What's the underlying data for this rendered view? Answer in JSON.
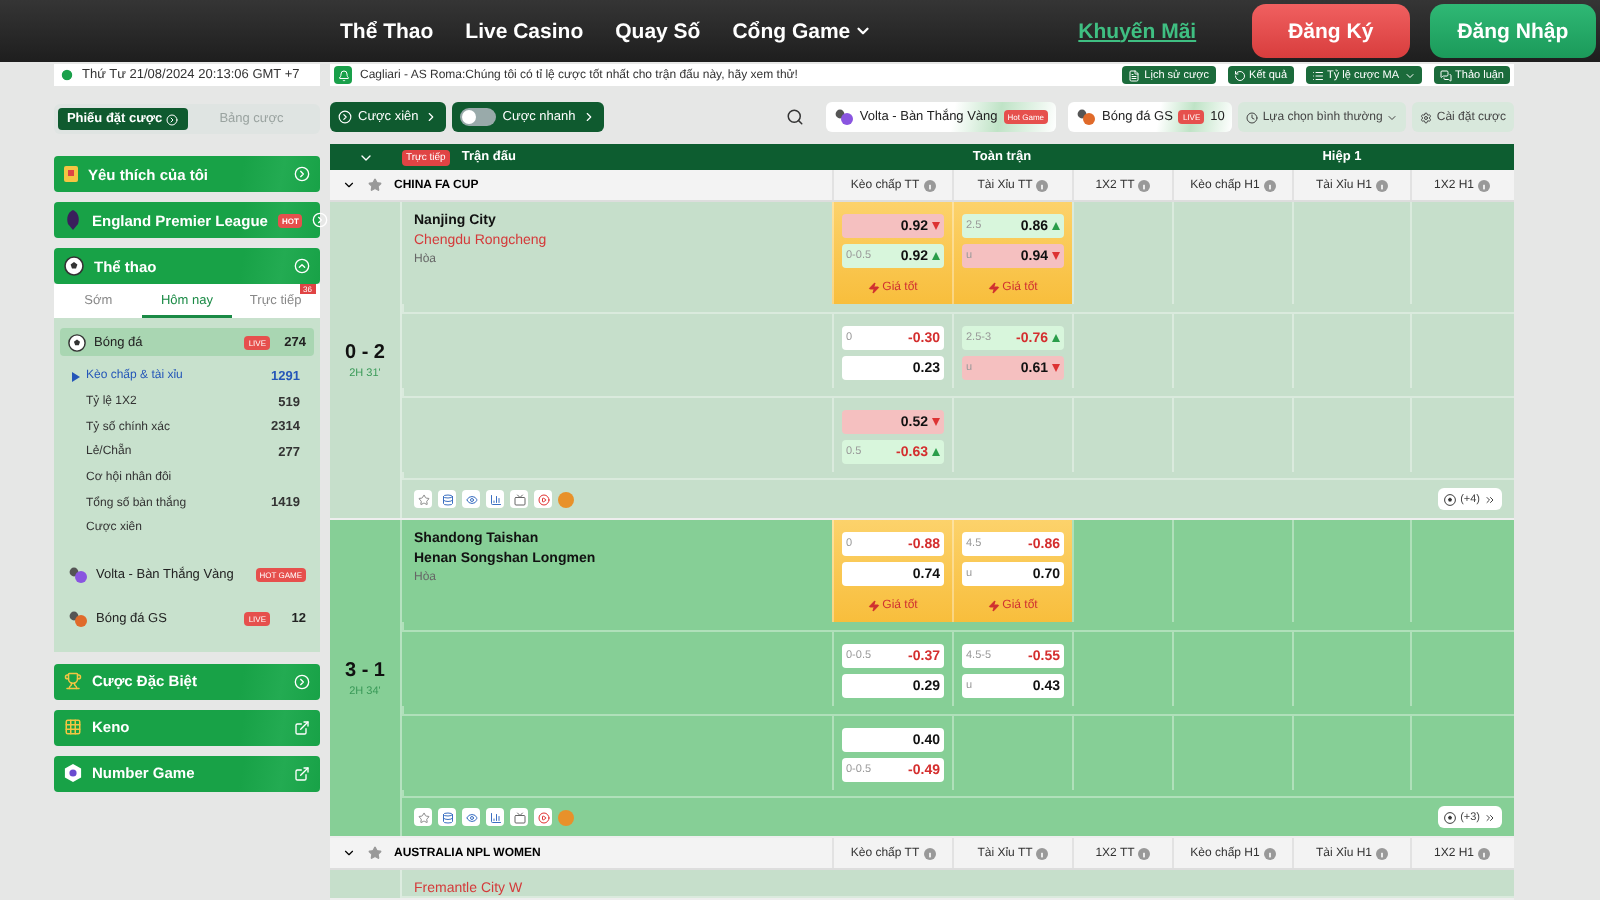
{
  "header": {
    "nav": [
      {
        "label": "Thể Thao",
        "kind": "link"
      },
      {
        "label": "Live Casino",
        "kind": "link"
      },
      {
        "label": "Quay Số",
        "kind": "link"
      },
      {
        "label": "Cổng Game",
        "kind": "dropdown"
      }
    ],
    "promo": "Khuyến Mãi",
    "buttons": [
      {
        "label": "Đăng Ký",
        "kind": "register"
      },
      {
        "label": "Đăng Nhập",
        "kind": "login"
      }
    ]
  },
  "clock": "Thứ Tư 21/08/2024 20:13:06 GMT +7",
  "ticker": "Cagliari - AS Roma:Chúng tôi có tỉ lệ cược tốt nhất cho trận đấu này, hãy xem thử!",
  "tools": [
    {
      "label": "Lịch sử cược",
      "kind": "history"
    },
    {
      "label": "Kết quả",
      "kind": "results"
    },
    {
      "label": "Tỷ lệ cược MA",
      "kind": "odds"
    },
    {
      "label": "Thảo luận",
      "kind": "chat"
    }
  ],
  "sidebar": {
    "slip_tabs": [
      {
        "label": "Phiếu đặt cược",
        "selected": true
      },
      {
        "label": "Bảng cược",
        "selected": false
      }
    ],
    "sections": [
      {
        "label": "Yêu thích của tôi",
        "kind": "favorites"
      },
      {
        "label": "England Premier League",
        "kind": "league",
        "badge": "HOT"
      }
    ],
    "sports": {
      "label": "Thể thao",
      "expanded": true,
      "period_tabs": [
        {
          "label": "Sớm",
          "selected": false
        },
        {
          "label": "Hôm nay",
          "selected": true
        },
        {
          "label": "Trực tiếp",
          "selected": false,
          "badge": "36"
        }
      ],
      "items": [
        {
          "label": "Bóng đá",
          "kind": "ball",
          "badge": "LIVE",
          "count": "274",
          "expanded": true,
          "children": [
            {
              "label": "Kèo chấp & tài xỉu",
              "count": "1291",
              "selected": true
            },
            {
              "label": "Tỷ lệ 1X2",
              "count": "519",
              "selected": false
            },
            {
              "label": "Tỷ số chính xác",
              "count": "2314",
              "selected": false
            },
            {
              "label": "Lẻ/Chẵn",
              "count": "277",
              "selected": false
            },
            {
              "label": "Cơ hội nhân đôi",
              "selected": false
            },
            {
              "label": "Tổng số bàn thắng",
              "count": "1419",
              "selected": false
            },
            {
              "label": "Cược xiên",
              "selected": false
            }
          ]
        },
        {
          "label": "Volta - Bàn Thắng Vàng",
          "kind": "volta",
          "badge": "HOT GAME",
          "expanded": false
        },
        {
          "label": "Bóng đá GS",
          "kind": "gs",
          "badge": "LIVE",
          "count": "12",
          "expanded": false
        }
      ]
    },
    "more_sections": [
      {
        "label": "Cược Đặc Biệt",
        "kind": "special",
        "external": false
      },
      {
        "label": "Keno",
        "kind": "keno",
        "external": true
      },
      {
        "label": "Number Game",
        "kind": "number",
        "external": true
      }
    ]
  },
  "toolbar": {
    "parlay": "Cược xiên",
    "quick_bet": {
      "label": "Cược nhanh",
      "on": false
    },
    "chips": [
      {
        "label": "Volta - Bàn Thắng Vàng",
        "kind": "volta",
        "badge": "Hot Game"
      },
      {
        "label": "Bóng đá GS",
        "kind": "gs",
        "badge": "LIVE",
        "count": "10"
      }
    ],
    "view_select": "Lựa chọn bình thường",
    "settings": "Cài đặt cược"
  },
  "table": {
    "live_badge": "Trực tiếp",
    "match_column": "Trận đấu",
    "groups": [
      "Toàn trận",
      "Hiệp 1"
    ],
    "leagues": [
      {
        "name": "CHINA FA CUP",
        "columns": [
          "Kèo chấp TT",
          "Tài Xỉu TT",
          "1X2 TT",
          "Kèo chấp H1",
          "Tài Xỉu H1",
          "1X2 H1"
        ],
        "matches": [
          {
            "score": "0 - 2",
            "time": "2H 31'",
            "selected": false,
            "teams": [
              {
                "name": "Nanjing City",
                "highlighted": false
              },
              {
                "name": "Chengdu Rongcheng",
                "highlighted": true
              }
            ],
            "draw": "Hòa",
            "more": "(+4)",
            "rows": [
              {
                "handicap": {
                  "best": "Giá tốt",
                  "cells": [
                    {
                      "value": "0.92",
                      "up": false,
                      "down": true,
                      "negative": false
                    },
                    {
                      "line": "0-0.5",
                      "value": "0.92",
                      "up": true,
                      "down": false,
                      "negative": false
                    }
                  ]
                },
                "total": {
                  "best": "Giá tốt",
                  "cells": [
                    {
                      "line": "2.5",
                      "value": "0.86",
                      "up": true,
                      "down": false,
                      "negative": false
                    },
                    {
                      "line": "u",
                      "value": "0.94",
                      "up": false,
                      "down": true,
                      "negative": false
                    }
                  ]
                }
              },
              {
                "handicap": {
                  "cells": [
                    {
                      "line": "0",
                      "value": "-0.30",
                      "up": false,
                      "down": false,
                      "negative": true
                    },
                    {
                      "value": "0.23",
                      "up": false,
                      "down": false,
                      "negative": false
                    }
                  ]
                },
                "total": {
                  "cells": [
                    {
                      "line": "2.5-3",
                      "value": "-0.76",
                      "up": true,
                      "down": false,
                      "negative": true
                    },
                    {
                      "line": "u",
                      "value": "0.61",
                      "up": false,
                      "down": true,
                      "negative": false
                    }
                  ]
                }
              },
              {
                "handicap": {
                  "cells": [
                    {
                      "value": "0.52",
                      "up": false,
                      "down": true,
                      "negative": false
                    },
                    {
                      "line": "0.5",
                      "value": "-0.63",
                      "up": true,
                      "down": false,
                      "negative": true
                    }
                  ]
                }
              }
            ]
          },
          {
            "score": "3 - 1",
            "time": "2H 34'",
            "selected": true,
            "teams": [
              {
                "name": "Shandong Taishan",
                "highlighted": false
              },
              {
                "name": "Henan Songshan Longmen",
                "highlighted": false
              }
            ],
            "draw": "Hòa",
            "more": "(+3)",
            "rows": [
              {
                "handicap": {
                  "best": "Giá tốt",
                  "cells": [
                    {
                      "line": "0",
                      "value": "-0.88",
                      "up": false,
                      "down": false,
                      "negative": true
                    },
                    {
                      "value": "0.74",
                      "up": false,
                      "down": false,
                      "negative": false
                    }
                  ]
                },
                "total": {
                  "best": "Giá tốt",
                  "cells": [
                    {
                      "line": "4.5",
                      "value": "-0.86",
                      "up": false,
                      "down": false,
                      "negative": true
                    },
                    {
                      "line": "u",
                      "value": "0.70",
                      "up": false,
                      "down": false,
                      "negative": false
                    }
                  ]
                }
              },
              {
                "handicap": {
                  "cells": [
                    {
                      "line": "0-0.5",
                      "value": "-0.37",
                      "up": false,
                      "down": false,
                      "negative": true
                    },
                    {
                      "value": "0.29",
                      "up": false,
                      "down": false,
                      "negative": false
                    }
                  ]
                },
                "total": {
                  "cells": [
                    {
                      "line": "4.5-5",
                      "value": "-0.55",
                      "up": false,
                      "down": false,
                      "negative": true
                    },
                    {
                      "line": "u",
                      "value": "0.43",
                      "up": false,
                      "down": false,
                      "negative": false
                    }
                  ]
                }
              },
              {
                "handicap": {
                  "cells": [
                    {
                      "value": "0.40",
                      "up": false,
                      "down": false,
                      "negative": false
                    },
                    {
                      "line": "0-0.5",
                      "value": "-0.49",
                      "up": false,
                      "down": false,
                      "negative": true
                    }
                  ]
                }
              }
            ]
          }
        ]
      },
      {
        "name": "AUSTRALIA NPL WOMEN",
        "columns": [
          "Kèo chấp TT",
          "Tài Xỉu TT",
          "1X2 TT",
          "Kèo chấp H1",
          "Tài Xỉu H1",
          "1X2 H1"
        ],
        "matches": [
          {
            "selected": false,
            "teams": [
              {
                "name": "Fremantle City W",
                "highlighted": true
              }
            ]
          }
        ]
      }
    ]
  }
}
